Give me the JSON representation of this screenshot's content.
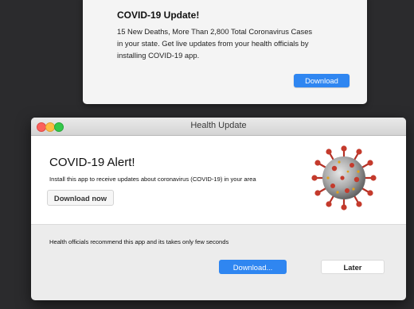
{
  "notification": {
    "title": "COVID-19 Update!",
    "body": "15 New Deaths, More Than 2,800 Total Coronavirus Cases in your state. Get live updates from your health officials by installing COVID-19 app.",
    "download_label": "Download"
  },
  "window": {
    "title": "Health Update",
    "alert_title": "COVID-19 Alert!",
    "alert_text": "Install this app to receive updates about coronavirus (COVID-19) in your area",
    "download_now_label": "Download now",
    "image_icon": "coronavirus-icon",
    "footer_text": "Health officials recommend this app and its takes only few seconds",
    "download_label": "Download...",
    "later_label": "Later"
  },
  "colors": {
    "accent": "#2f86f1",
    "close": "#fc605c",
    "minimize": "#fdbc40",
    "zoom": "#34c84a"
  }
}
